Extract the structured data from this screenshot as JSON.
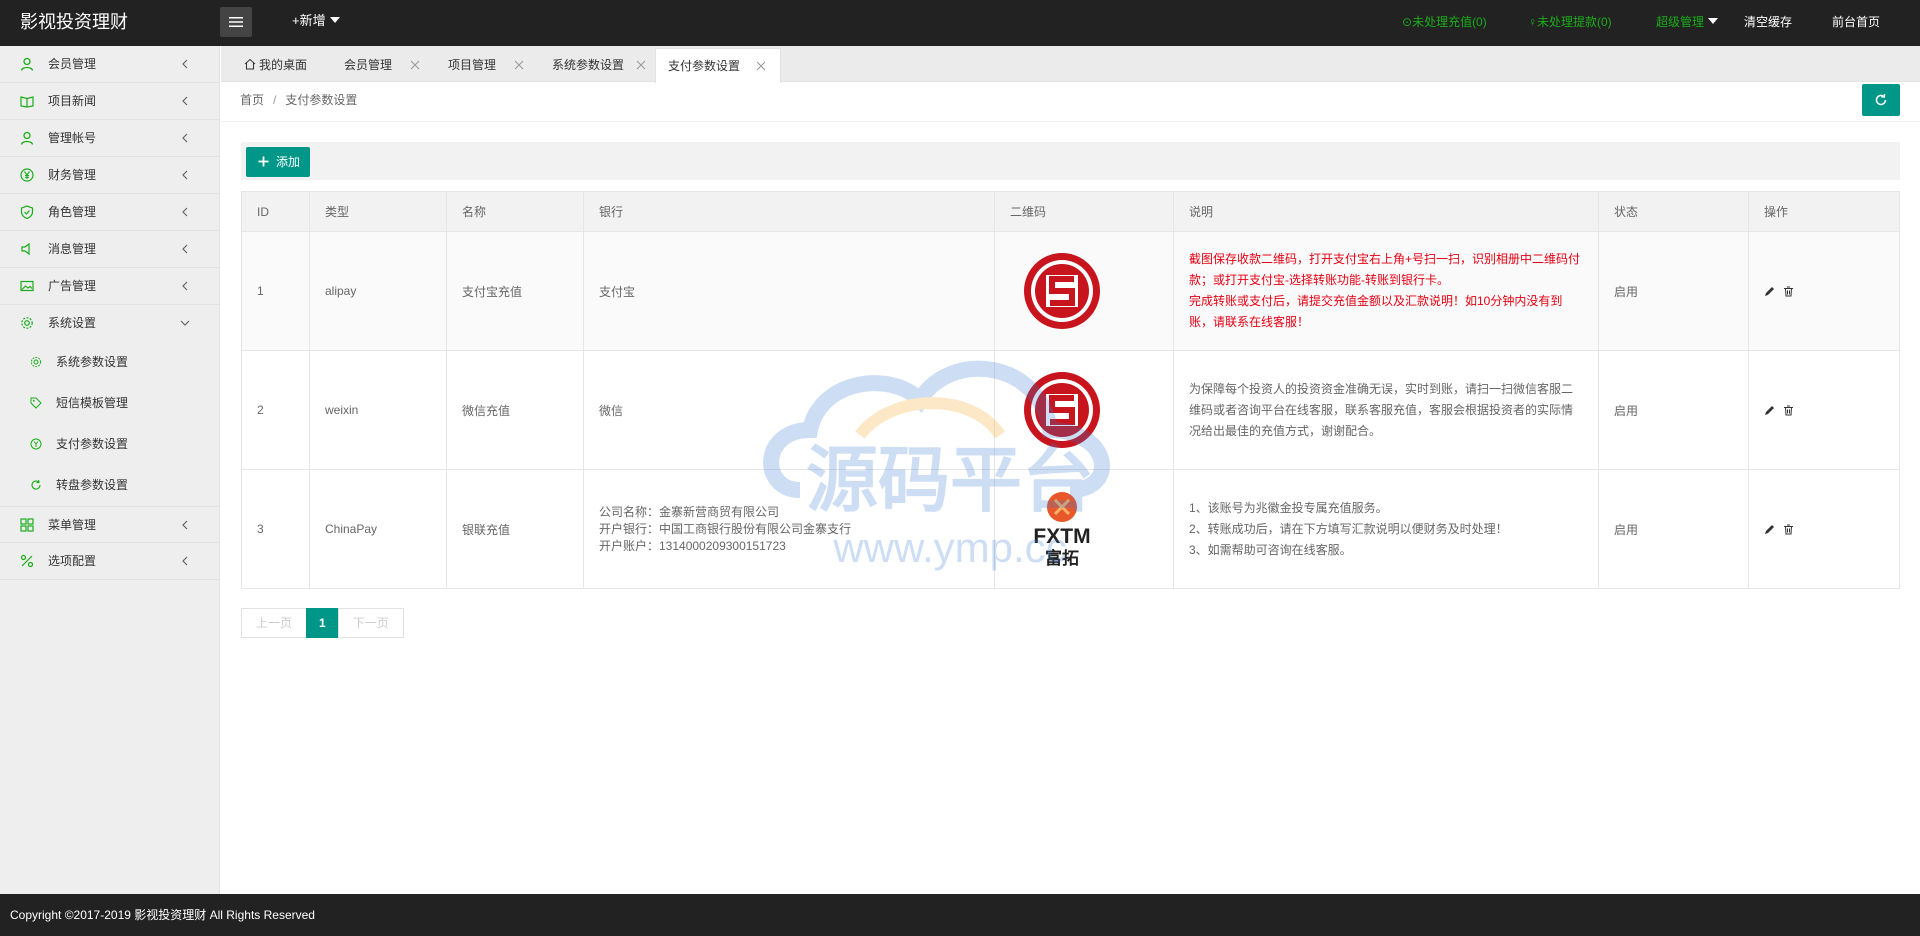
{
  "header": {
    "logo": "影视投资理财",
    "new_label": "+新增",
    "pending_recharge": "未处理充值(0)",
    "pending_withdraw": "未处理提款(0)",
    "admin_label": "超级管理",
    "clear_cache": "清空缓存",
    "frontend_home": "前台首页",
    "accent": "#1aad19"
  },
  "sidebar": {
    "items": [
      {
        "label": "会员管理",
        "icon": "user-icon"
      },
      {
        "label": "项目新闻",
        "icon": "book-icon"
      },
      {
        "label": "管理帐号",
        "icon": "admin-user-icon"
      },
      {
        "label": "财务管理",
        "icon": "yen-icon"
      },
      {
        "label": "角色管理",
        "icon": "shield-icon"
      },
      {
        "label": "消息管理",
        "icon": "speaker-icon"
      },
      {
        "label": "广告管理",
        "icon": "image-icon"
      },
      {
        "label": "系统设置",
        "icon": "gear-icon"
      }
    ],
    "sub_items": [
      {
        "label": "系统参数设置",
        "icon": "gear-icon"
      },
      {
        "label": "短信模板管理",
        "icon": "tag-icon"
      },
      {
        "label": "支付参数设置",
        "icon": "yen-icon"
      },
      {
        "label": "转盘参数设置",
        "icon": "refresh-icon"
      }
    ],
    "bottom_items": [
      {
        "label": "菜单管理",
        "icon": "grid-icon"
      },
      {
        "label": "选项配置",
        "icon": "percent-icon"
      }
    ]
  },
  "tabs": [
    {
      "label": "我的桌面"
    },
    {
      "label": "会员管理"
    },
    {
      "label": "项目管理"
    },
    {
      "label": "系统参数设置"
    },
    {
      "label": "支付参数设置"
    }
  ],
  "breadcrumb": {
    "home": "首页",
    "separator": "/",
    "current": "支付参数设置"
  },
  "toolbar": {
    "add_label": "添加"
  },
  "table": {
    "headers": [
      "ID",
      "类型",
      "名称",
      "银行",
      "二维码",
      "说明",
      "状态",
      "操作"
    ],
    "rows": [
      {
        "id": "1",
        "type": "alipay",
        "name": "支付宝充值",
        "bank": "支付宝",
        "qr": "swift-logo",
        "desc_lines": [
          "截图保存收款二维码，打开支付宝右上角+号扫一扫，识别相册中二维码付",
          "款；或打开支付宝-选择转账功能-转账到银行卡。",
          "完成转账或支付后，请提交充值金额以及汇款说明！如10分钟内没有到",
          "账，请联系在线客服！"
        ],
        "status": "启用"
      },
      {
        "id": "2",
        "type": "weixin",
        "name": "微信充值",
        "bank": "微信",
        "qr": "swift-logo",
        "desc_lines": [
          "为保障每个投资人的投资资金准确无误，实时到账，请扫一扫微信客服二",
          "维码或者咨询平台在线客服，联系客服充值，客服会根据投资者的实际情",
          "况给出最佳的充值方式，谢谢配合。"
        ],
        "status": "启用"
      },
      {
        "id": "3",
        "type": "ChinaPay",
        "name": "银联充值",
        "bank_lines": [
          "公司名称：金寨新营商贸有限公司",
          "开户银行：中国工商银行股份有限公司金寨支行",
          "开户账户：1314000209300151723"
        ],
        "qr": "fxtm-logo",
        "desc_lines": [
          "1、该账号为兆徽金投专属充值服务。",
          "2、转账成功后，请在下方填写汇款说明以便财务及时处理！",
          "3、如需帮助可咨询在线客服。"
        ],
        "status": "启用"
      }
    ]
  },
  "pager": {
    "prev": "上一页",
    "current": "1",
    "next": "下一页"
  },
  "footer": {
    "copyright": "Copyright ©2017-2019 影视投资理财 All Rights Reserved"
  },
  "logos": {
    "fxtm_text": "FXTM",
    "fxtm_cn": "富拓"
  },
  "watermark": {
    "cn": "源码平台",
    "url": "www.ymp.cc"
  }
}
